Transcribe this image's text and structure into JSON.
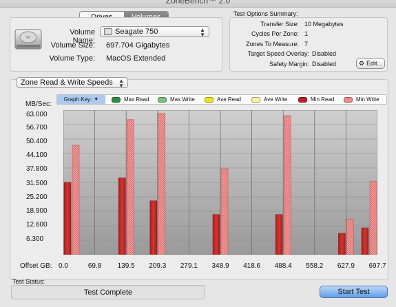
{
  "window": {
    "title": "ZoneBench™ 2.0"
  },
  "tabs": [
    {
      "label": "Drives"
    },
    {
      "label": "Volumes"
    }
  ],
  "volume": {
    "name_label": "Volume Name:",
    "name_value": "Seagate 750",
    "size_label": "Volume Size:",
    "size_value": "697.704 Gigabytes",
    "type_label": "Volume Type:",
    "type_value": "MacOS Extended"
  },
  "options": {
    "title": "Test Options Summary:",
    "rows": [
      {
        "label": "Transfer Size:",
        "value": "10 Megabytes"
      },
      {
        "label": "Cycles Per Zone:",
        "value": "1"
      },
      {
        "label": "Zones To Measure:",
        "value": "7"
      },
      {
        "label": "Target Speed Overlay:",
        "value": "Disabled"
      },
      {
        "label": "Safety Margin:",
        "value": "Disabled"
      }
    ],
    "edit_label": "Edit..."
  },
  "graph_select": {
    "value": "Zone Read & Write Speeds"
  },
  "graph_key": {
    "label": "Graph Key:",
    "items": [
      {
        "label": "Max Read",
        "color": "#2e8b3c"
      },
      {
        "label": "Max Write",
        "color": "#7fbf7f"
      },
      {
        "label": "Ave Read",
        "color": "#f2e21e"
      },
      {
        "label": "Ave Write",
        "color": "#f6f2a0"
      },
      {
        "label": "Min Read",
        "color": "#b82323"
      },
      {
        "label": "Min Write",
        "color": "#e88a8a"
      }
    ]
  },
  "chart_data": {
    "type": "bar",
    "ylabel": "MB/Sec:",
    "xlabel": "Offset GB:",
    "ylim": [
      0,
      63
    ],
    "y_ticks": [
      "63.000",
      "56.700",
      "50.400",
      "44.100",
      "37.800",
      "31.500",
      "25.200",
      "18.900",
      "12.600",
      "6.300"
    ],
    "x_ticks": [
      "0.0",
      "69.8",
      "139.5",
      "209.3",
      "279.1",
      "348.9",
      "418.6",
      "488.4",
      "558.2",
      "627.9",
      "697.7"
    ],
    "categories": [
      "0.0",
      "139.5",
      "209.3",
      "348.9",
      "488.4",
      "627.9",
      "697.7"
    ],
    "series": [
      {
        "name": "Min Read",
        "color": "#c02a2a",
        "values": [
          31.5,
          33.5,
          23.5,
          17.5,
          17.5,
          9.3,
          11.7
        ]
      },
      {
        "name": "Min Write",
        "color": "#e06060",
        "values": [
          47.7,
          58.9,
          61.6,
          37.5,
          60.6,
          15.4,
          31.9
        ]
      }
    ]
  },
  "status": {
    "label": "Test Status:",
    "value": "Test Complete",
    "start_label": "Start Test"
  }
}
